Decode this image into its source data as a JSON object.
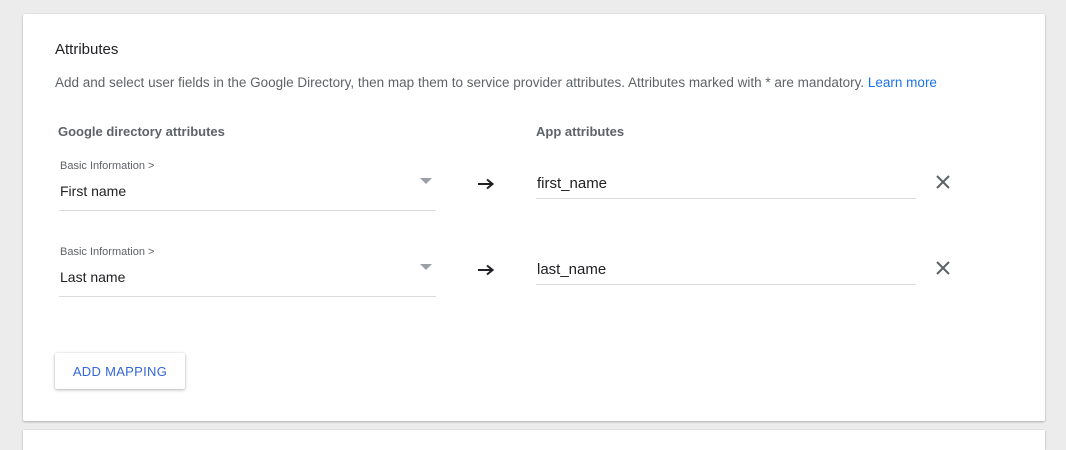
{
  "section": {
    "title": "Attributes",
    "description": "Add and select user fields in the Google Directory, then map them to service provider attributes. Attributes marked with * are mandatory.",
    "learn_more": "Learn more"
  },
  "columns": {
    "left": "Google directory attributes",
    "right": "App attributes"
  },
  "mappings": [
    {
      "group": "Basic Information >",
      "field": "First name",
      "app_attribute": "first_name",
      "arrow_icon": "arrow-right-icon",
      "remove_icon": "close-icon"
    },
    {
      "group": "Basic Information >",
      "field": "Last name",
      "app_attribute": "last_name",
      "arrow_icon": "arrow-right-icon",
      "remove_icon": "close-icon"
    }
  ],
  "actions": {
    "add_mapping": "ADD MAPPING"
  },
  "colors": {
    "link": "#1a73e8",
    "button_text": "#3367d6",
    "background": "#ececec"
  }
}
